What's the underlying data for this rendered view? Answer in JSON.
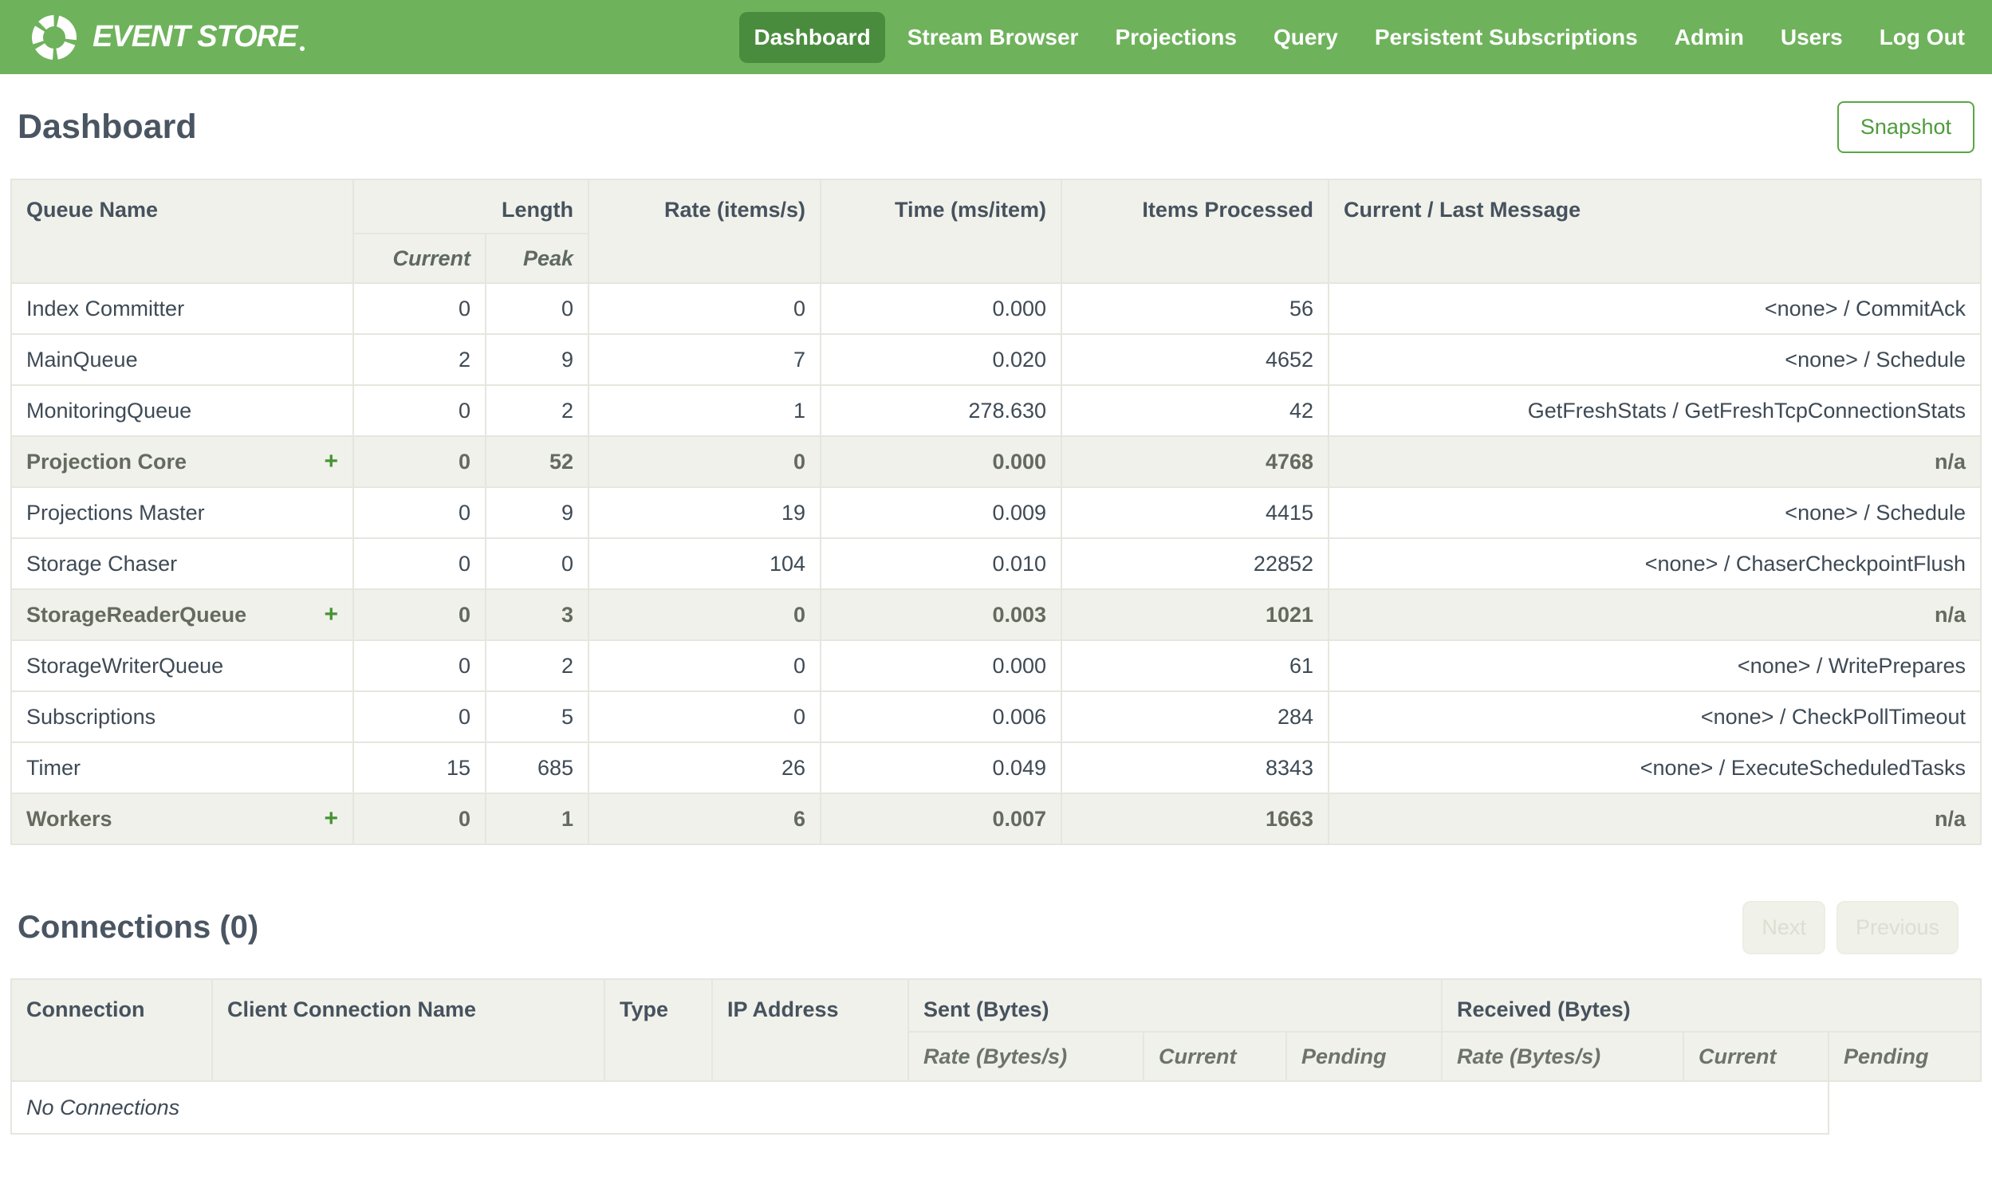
{
  "colors": {
    "navbar_green": "#6fb25c",
    "active_item_green": "#4a8c3e",
    "accent_green": "#4f9b3d",
    "header_bg": "#f0f1ea"
  },
  "navbar": {
    "logo_text": "EVENT STORE",
    "logo_icon": "circular-arrows-swirl",
    "items": [
      {
        "label": "Dashboard",
        "active": true
      },
      {
        "label": "Stream Browser",
        "active": false
      },
      {
        "label": "Projections",
        "active": false
      },
      {
        "label": "Query",
        "active": false
      },
      {
        "label": "Persistent Subscriptions",
        "active": false
      },
      {
        "label": "Admin",
        "active": false
      },
      {
        "label": "Users",
        "active": false
      },
      {
        "label": "Log Out",
        "active": false
      }
    ]
  },
  "page": {
    "title": "Dashboard",
    "snapshot_button": "Snapshot"
  },
  "queues_table": {
    "expand_symbol": "+",
    "headers": {
      "queue_name": "Queue Name",
      "length": "Length",
      "current": "Current",
      "peak": "Peak",
      "rate": "Rate (items/s)",
      "time": "Time (ms/item)",
      "items_processed": "Items Processed",
      "message": "Current / Last Message"
    },
    "rows": [
      {
        "name": "Index Committer",
        "group": false,
        "current": "0",
        "peak": "0",
        "rate": "0",
        "time": "0.000",
        "items": "56",
        "message": "<none> / CommitAck"
      },
      {
        "name": "MainQueue",
        "group": false,
        "current": "2",
        "peak": "9",
        "rate": "7",
        "time": "0.020",
        "items": "4652",
        "message": "<none> / Schedule"
      },
      {
        "name": "MonitoringQueue",
        "group": false,
        "current": "0",
        "peak": "2",
        "rate": "1",
        "time": "278.630",
        "items": "42",
        "message": "GetFreshStats / GetFreshTcpConnectionStats"
      },
      {
        "name": "Projection Core",
        "group": true,
        "current": "0",
        "peak": "52",
        "rate": "0",
        "time": "0.000",
        "items": "4768",
        "message": "n/a"
      },
      {
        "name": "Projections Master",
        "group": false,
        "current": "0",
        "peak": "9",
        "rate": "19",
        "time": "0.009",
        "items": "4415",
        "message": "<none> / Schedule"
      },
      {
        "name": "Storage Chaser",
        "group": false,
        "current": "0",
        "peak": "0",
        "rate": "104",
        "time": "0.010",
        "items": "22852",
        "message": "<none> / ChaserCheckpointFlush"
      },
      {
        "name": "StorageReaderQueue",
        "group": true,
        "current": "0",
        "peak": "3",
        "rate": "0",
        "time": "0.003",
        "items": "1021",
        "message": "n/a"
      },
      {
        "name": "StorageWriterQueue",
        "group": false,
        "current": "0",
        "peak": "2",
        "rate": "0",
        "time": "0.000",
        "items": "61",
        "message": "<none> / WritePrepares"
      },
      {
        "name": "Subscriptions",
        "group": false,
        "current": "0",
        "peak": "5",
        "rate": "0",
        "time": "0.006",
        "items": "284",
        "message": "<none> / CheckPollTimeout"
      },
      {
        "name": "Timer",
        "group": false,
        "current": "15",
        "peak": "685",
        "rate": "26",
        "time": "0.049",
        "items": "8343",
        "message": "<none> / ExecuteScheduledTasks"
      },
      {
        "name": "Workers",
        "group": true,
        "current": "0",
        "peak": "1",
        "rate": "6",
        "time": "0.007",
        "items": "1663",
        "message": "n/a"
      }
    ]
  },
  "connections": {
    "title": "Connections (0)",
    "next_button": "Next",
    "previous_button": "Previous",
    "headers": {
      "connection": "Connection",
      "client_connection_name": "Client Connection Name",
      "type": "Type",
      "ip_address": "IP Address",
      "sent": "Sent (Bytes)",
      "received": "Received (Bytes)",
      "rate": "Rate (Bytes/s)",
      "current": "Current",
      "pending": "Pending"
    },
    "empty_message": "No Connections"
  }
}
